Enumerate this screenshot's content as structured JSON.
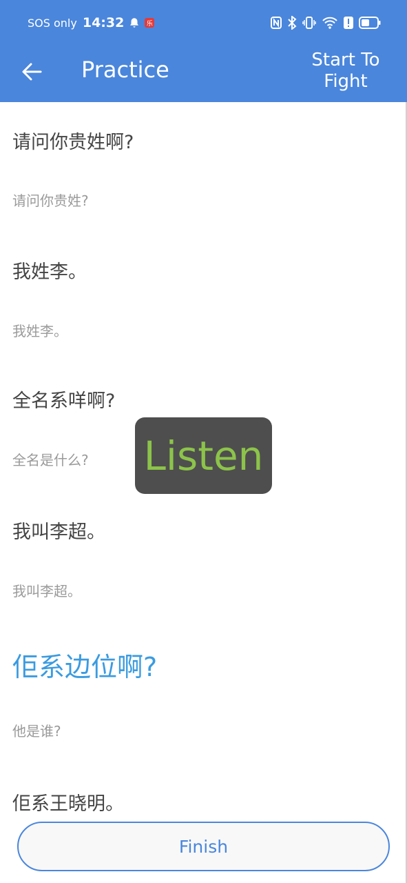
{
  "status_bar": {
    "carrier": "SOS only",
    "time": "14:32",
    "notif_badge": "乐"
  },
  "toolbar": {
    "title": "Practice",
    "action_line1": "Start To",
    "action_line2": "Fight"
  },
  "phrases": [
    {
      "cantonese": "请问你贵姓啊?",
      "mandarin": "请问你贵姓?"
    },
    {
      "cantonese": "我姓李。",
      "mandarin": "我姓李。"
    },
    {
      "cantonese": "全名系咩啊?",
      "mandarin": "全名是什么?"
    },
    {
      "cantonese": "我叫李超。",
      "mandarin": "我叫李超。"
    },
    {
      "cantonese": "佢系边位啊?",
      "mandarin": "他是谁?",
      "active": true
    },
    {
      "cantonese": "佢系王晓明。"
    }
  ],
  "listen_label": "Listen",
  "finish_label": "Finish",
  "colors": {
    "appbar": "#4a86dc",
    "active_text": "#3a9be0",
    "listen_text": "#8cc34a",
    "listen_bg": "#4e4e4e"
  }
}
